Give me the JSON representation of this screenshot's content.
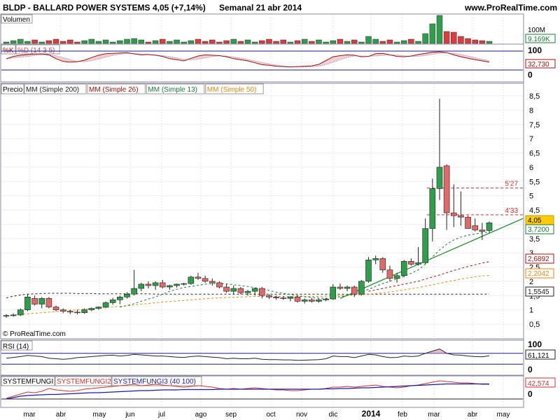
{
  "header": {
    "symbol": "BLDP - BALLARD POWER SYSTEMS",
    "price_change": "4,05 (+7,14%)",
    "period_date": "Semanal  21 abr 2014",
    "site": "www.ProRealTime.com"
  },
  "panels": {
    "volume": {
      "label": "Volumen",
      "scale_label": "100M",
      "last_value": "9.169K"
    },
    "stochastic": {
      "k_label": "%K",
      "d_label": "%D (14 3 5)",
      "top_label": "100",
      "bottom_label": "0",
      "last_value": "32,730"
    },
    "price": {
      "label": "Precio",
      "legend": [
        {
          "text": "MM (Simple 200)",
          "color": "#222222"
        },
        {
          "text": "MM (Simple 26)",
          "color": "#a01010"
        },
        {
          "text": "MM (Simple 13)",
          "color": "#1a7a3a"
        },
        {
          "text": "MM (Simple 50)",
          "color": "#e08a10"
        }
      ],
      "resistance_labels": [
        "5'27",
        "4'33"
      ],
      "y_ticks": [
        "8,5",
        "8",
        "7,5",
        "7",
        "6,5",
        "6",
        "5,5",
        "5",
        "4,5",
        "4",
        "3,5",
        "3",
        "2,5",
        "2",
        "1,5",
        "1",
        "0,5"
      ],
      "price_tags": [
        {
          "text": "4,05",
          "bg": "#ffcc00",
          "fg": "#000000"
        },
        {
          "text": "3,7200",
          "bg": "#ffffff",
          "fg": "#1a7a3a"
        },
        {
          "text": "2,6892",
          "bg": "#ffffff",
          "fg": "#a01010"
        },
        {
          "text": "2,2042",
          "bg": "#ffffff",
          "fg": "#e08a10"
        },
        {
          "text": "1,5545",
          "bg": "#ffffff",
          "fg": "#222222"
        }
      ],
      "copyright": "© ProRealTime.com"
    },
    "rsi": {
      "label": "RSI (14)",
      "top_label": "100",
      "last_value": "61,121",
      "bottom_label": "0"
    },
    "system": {
      "label1": "SYSTEMFUNGI",
      "label2": "SYSTEMFUNGI2",
      "label3": "SYSTEMFUNGI3 (40 100)",
      "last_value": "42,574",
      "zero_label": "0"
    }
  },
  "x_axis": {
    "labels": [
      "mar",
      "abr",
      "may",
      "jun",
      "jul",
      "ago",
      "sep",
      "oct",
      "nov",
      "dic",
      "2014",
      "feb",
      "mar",
      "abr",
      "may"
    ]
  },
  "colors": {
    "up": "#2e9e4a",
    "down": "#e06a6a",
    "grid": "#d0d0d0",
    "accent": "#1a1a8a"
  },
  "chart_data": {
    "type": "candlestick",
    "title": "BLDP - BALLARD POWER SYSTEMS",
    "ylim": [
      0.2,
      8.8
    ],
    "candles": [
      {
        "o": 0.78,
        "h": 0.85,
        "l": 0.72,
        "c": 0.8
      },
      {
        "o": 0.8,
        "h": 0.88,
        "l": 0.76,
        "c": 0.82
      },
      {
        "o": 0.82,
        "h": 1.05,
        "l": 0.78,
        "c": 1.0
      },
      {
        "o": 1.0,
        "h": 1.55,
        "l": 0.95,
        "c": 1.45
      },
      {
        "o": 1.4,
        "h": 1.5,
        "l": 1.15,
        "c": 1.2
      },
      {
        "o": 1.2,
        "h": 1.45,
        "l": 1.05,
        "c": 1.4
      },
      {
        "o": 1.4,
        "h": 1.45,
        "l": 1.05,
        "c": 1.1
      },
      {
        "o": 1.1,
        "h": 1.15,
        "l": 0.95,
        "c": 1.0
      },
      {
        "o": 1.0,
        "h": 1.05,
        "l": 0.88,
        "c": 0.95
      },
      {
        "o": 0.95,
        "h": 1.0,
        "l": 0.85,
        "c": 0.92
      },
      {
        "o": 0.92,
        "h": 1.0,
        "l": 0.85,
        "c": 0.9
      },
      {
        "o": 0.9,
        "h": 1.05,
        "l": 0.86,
        "c": 1.0
      },
      {
        "o": 1.0,
        "h": 1.08,
        "l": 0.95,
        "c": 1.05
      },
      {
        "o": 1.05,
        "h": 1.12,
        "l": 1.0,
        "c": 1.1
      },
      {
        "o": 1.1,
        "h": 1.3,
        "l": 1.05,
        "c": 1.25
      },
      {
        "o": 1.25,
        "h": 1.42,
        "l": 1.18,
        "c": 1.35
      },
      {
        "o": 1.35,
        "h": 1.5,
        "l": 1.2,
        "c": 1.45
      },
      {
        "o": 1.45,
        "h": 1.62,
        "l": 1.4,
        "c": 1.55
      },
      {
        "o": 1.55,
        "h": 2.4,
        "l": 1.5,
        "c": 1.75
      },
      {
        "o": 1.75,
        "h": 1.95,
        "l": 1.65,
        "c": 1.9
      },
      {
        "o": 1.9,
        "h": 2.0,
        "l": 1.75,
        "c": 1.85
      },
      {
        "o": 1.85,
        "h": 2.0,
        "l": 1.7,
        "c": 1.95
      },
      {
        "o": 1.95,
        "h": 2.05,
        "l": 1.75,
        "c": 1.8
      },
      {
        "o": 1.8,
        "h": 1.88,
        "l": 1.7,
        "c": 1.85
      },
      {
        "o": 1.85,
        "h": 1.92,
        "l": 1.78,
        "c": 1.9
      },
      {
        "o": 1.9,
        "h": 1.95,
        "l": 1.85,
        "c": 1.92
      },
      {
        "o": 1.92,
        "h": 2.2,
        "l": 1.88,
        "c": 2.15
      },
      {
        "o": 2.15,
        "h": 2.3,
        "l": 2.05,
        "c": 2.1
      },
      {
        "o": 2.1,
        "h": 2.2,
        "l": 1.95,
        "c": 2.0
      },
      {
        "o": 2.0,
        "h": 2.1,
        "l": 1.85,
        "c": 1.95
      },
      {
        "o": 1.95,
        "h": 2.0,
        "l": 1.75,
        "c": 1.8
      },
      {
        "o": 1.8,
        "h": 1.9,
        "l": 1.6,
        "c": 1.65
      },
      {
        "o": 1.65,
        "h": 1.85,
        "l": 1.55,
        "c": 1.75
      },
      {
        "o": 1.75,
        "h": 1.8,
        "l": 1.55,
        "c": 1.6
      },
      {
        "o": 1.6,
        "h": 1.7,
        "l": 1.5,
        "c": 1.65
      },
      {
        "o": 1.65,
        "h": 1.78,
        "l": 1.5,
        "c": 1.75
      },
      {
        "o": 1.75,
        "h": 1.8,
        "l": 1.4,
        "c": 1.5
      },
      {
        "o": 1.5,
        "h": 1.55,
        "l": 1.38,
        "c": 1.45
      },
      {
        "o": 1.45,
        "h": 1.5,
        "l": 1.35,
        "c": 1.42
      },
      {
        "o": 1.42,
        "h": 1.48,
        "l": 1.35,
        "c": 1.4
      },
      {
        "o": 1.4,
        "h": 1.48,
        "l": 1.3,
        "c": 1.45
      },
      {
        "o": 1.45,
        "h": 1.5,
        "l": 1.25,
        "c": 1.3
      },
      {
        "o": 1.3,
        "h": 1.4,
        "l": 1.22,
        "c": 1.35
      },
      {
        "o": 1.35,
        "h": 1.42,
        "l": 1.25,
        "c": 1.3
      },
      {
        "o": 1.3,
        "h": 1.4,
        "l": 1.25,
        "c": 1.35
      },
      {
        "o": 1.35,
        "h": 1.42,
        "l": 1.3,
        "c": 1.38
      },
      {
        "o": 1.38,
        "h": 1.9,
        "l": 1.35,
        "c": 1.8
      },
      {
        "o": 1.8,
        "h": 1.92,
        "l": 1.7,
        "c": 1.75
      },
      {
        "o": 1.75,
        "h": 1.85,
        "l": 1.65,
        "c": 1.8
      },
      {
        "o": 1.8,
        "h": 1.85,
        "l": 1.45,
        "c": 1.55
      },
      {
        "o": 1.55,
        "h": 2.05,
        "l": 1.5,
        "c": 2.0
      },
      {
        "o": 2.0,
        "h": 2.85,
        "l": 1.95,
        "c": 2.75
      },
      {
        "o": 2.75,
        "h": 2.9,
        "l": 2.6,
        "c": 2.8
      },
      {
        "o": 2.8,
        "h": 2.85,
        "l": 2.3,
        "c": 2.4
      },
      {
        "o": 2.4,
        "h": 2.55,
        "l": 2.0,
        "c": 2.1
      },
      {
        "o": 2.1,
        "h": 2.3,
        "l": 1.95,
        "c": 2.2
      },
      {
        "o": 2.2,
        "h": 2.75,
        "l": 2.15,
        "c": 2.7
      },
      {
        "o": 2.7,
        "h": 2.8,
        "l": 2.55,
        "c": 2.6
      },
      {
        "o": 2.6,
        "h": 3.2,
        "l": 2.55,
        "c": 2.65
      },
      {
        "o": 2.65,
        "h": 4.2,
        "l": 2.6,
        "c": 3.85
      },
      {
        "o": 3.85,
        "h": 5.6,
        "l": 3.4,
        "c": 5.25
      },
      {
        "o": 5.25,
        "h": 8.4,
        "l": 4.85,
        "c": 6.0
      },
      {
        "o": 6.05,
        "h": 6.1,
        "l": 3.8,
        "c": 4.4
      },
      {
        "o": 4.4,
        "h": 5.4,
        "l": 3.9,
        "c": 4.3
      },
      {
        "o": 4.3,
        "h": 5.15,
        "l": 3.95,
        "c": 4.25
      },
      {
        "o": 4.25,
        "h": 4.3,
        "l": 3.85,
        "c": 3.85
      },
      {
        "o": 3.95,
        "h": 4.2,
        "l": 3.75,
        "c": 3.8
      },
      {
        "o": 3.8,
        "h": 4.05,
        "l": 3.45,
        "c": 3.75
      },
      {
        "o": 3.78,
        "h": 4.1,
        "l": 3.7,
        "c": 4.05
      }
    ],
    "resistance_levels": [
      5.27,
      4.33
    ],
    "moving_averages": [
      {
        "name": "MM (Simple 200)",
        "last": 1.5545
      },
      {
        "name": "MM (Simple 26)",
        "last": 2.6892
      },
      {
        "name": "MM (Simple 13)",
        "last": 3.72
      },
      {
        "name": "MM (Simple 50)",
        "last": 2.2042
      }
    ],
    "volume_last": "9.169K",
    "stochastic_last": 32.73,
    "rsi_last": 61.121,
    "system_last": 42.574
  }
}
